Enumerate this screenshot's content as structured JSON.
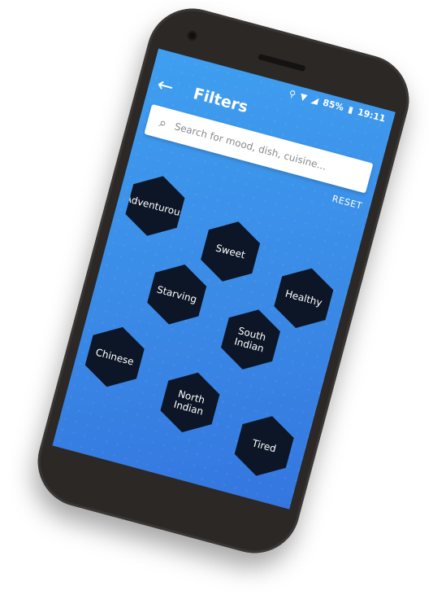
{
  "status_bar": {
    "battery": "85%",
    "time": "19:11"
  },
  "app_bar": {
    "title": "Filters",
    "back_icon": "arrow-left-icon"
  },
  "search": {
    "placeholder": "Search for mood, dish, cuisine..."
  },
  "reset_label": "RESET",
  "filters": [
    {
      "label": "Adventurous"
    },
    {
      "label": "Sweet"
    },
    {
      "label": "Healthy"
    },
    {
      "label": "Starving"
    },
    {
      "label": "South Indian"
    },
    {
      "label": "Chinese"
    },
    {
      "label": "North Indian"
    },
    {
      "label": "Tired"
    }
  ],
  "colors": {
    "screen_blue": "#3a8ae6",
    "chip_dark": "#0d1626",
    "phone_body": "#2b2826"
  }
}
